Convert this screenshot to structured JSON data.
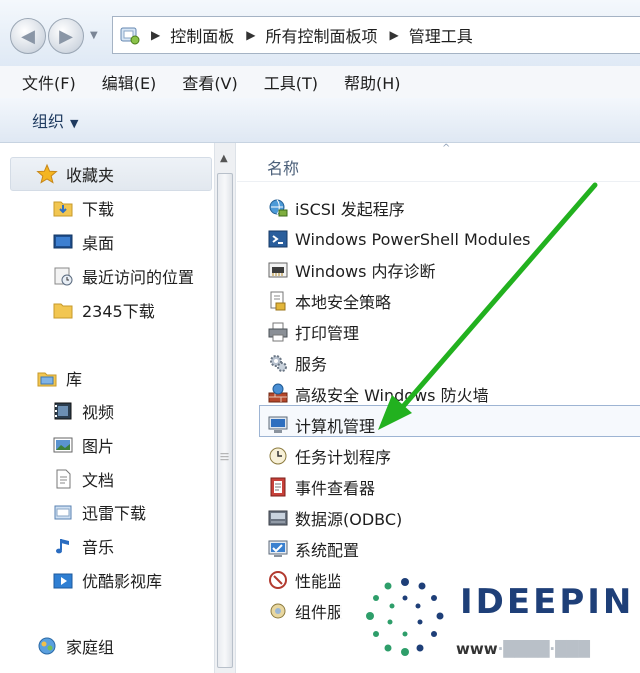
{
  "breadcrumb": {
    "items": [
      "控制面板",
      "所有控制面板项",
      "管理工具"
    ]
  },
  "menu": [
    "文件(F)",
    "编辑(E)",
    "查看(V)",
    "工具(T)",
    "帮助(H)"
  ],
  "toolbar": {
    "organize_label": "组织"
  },
  "nav": {
    "favorites": "收藏夹",
    "fav_items": [
      "下载",
      "桌面",
      "最近访问的位置",
      "2345下载"
    ],
    "library": "库",
    "lib_items": [
      "视频",
      "图片",
      "文档",
      "迅雷下载",
      "音乐",
      "优酷影视库"
    ],
    "homegroup": "家庭组"
  },
  "content": {
    "column_name": "名称",
    "items": [
      "iSCSI 发起程序",
      "Windows PowerShell Modules",
      "Windows 内存诊断",
      "本地安全策略",
      "打印管理",
      "服务",
      "高级安全 Windows 防火墙",
      "计算机管理",
      "任务计划程序",
      "事件查看器",
      "数据源(ODBC)",
      "系统配置",
      "性能监",
      "组件服"
    ]
  },
  "watermark": {
    "brand": "IDEEPIN",
    "url_prefix": "www"
  },
  "colors": {
    "arrow": "#22b11f",
    "brand": "#1e3f78",
    "selection": "#9db4d3"
  }
}
